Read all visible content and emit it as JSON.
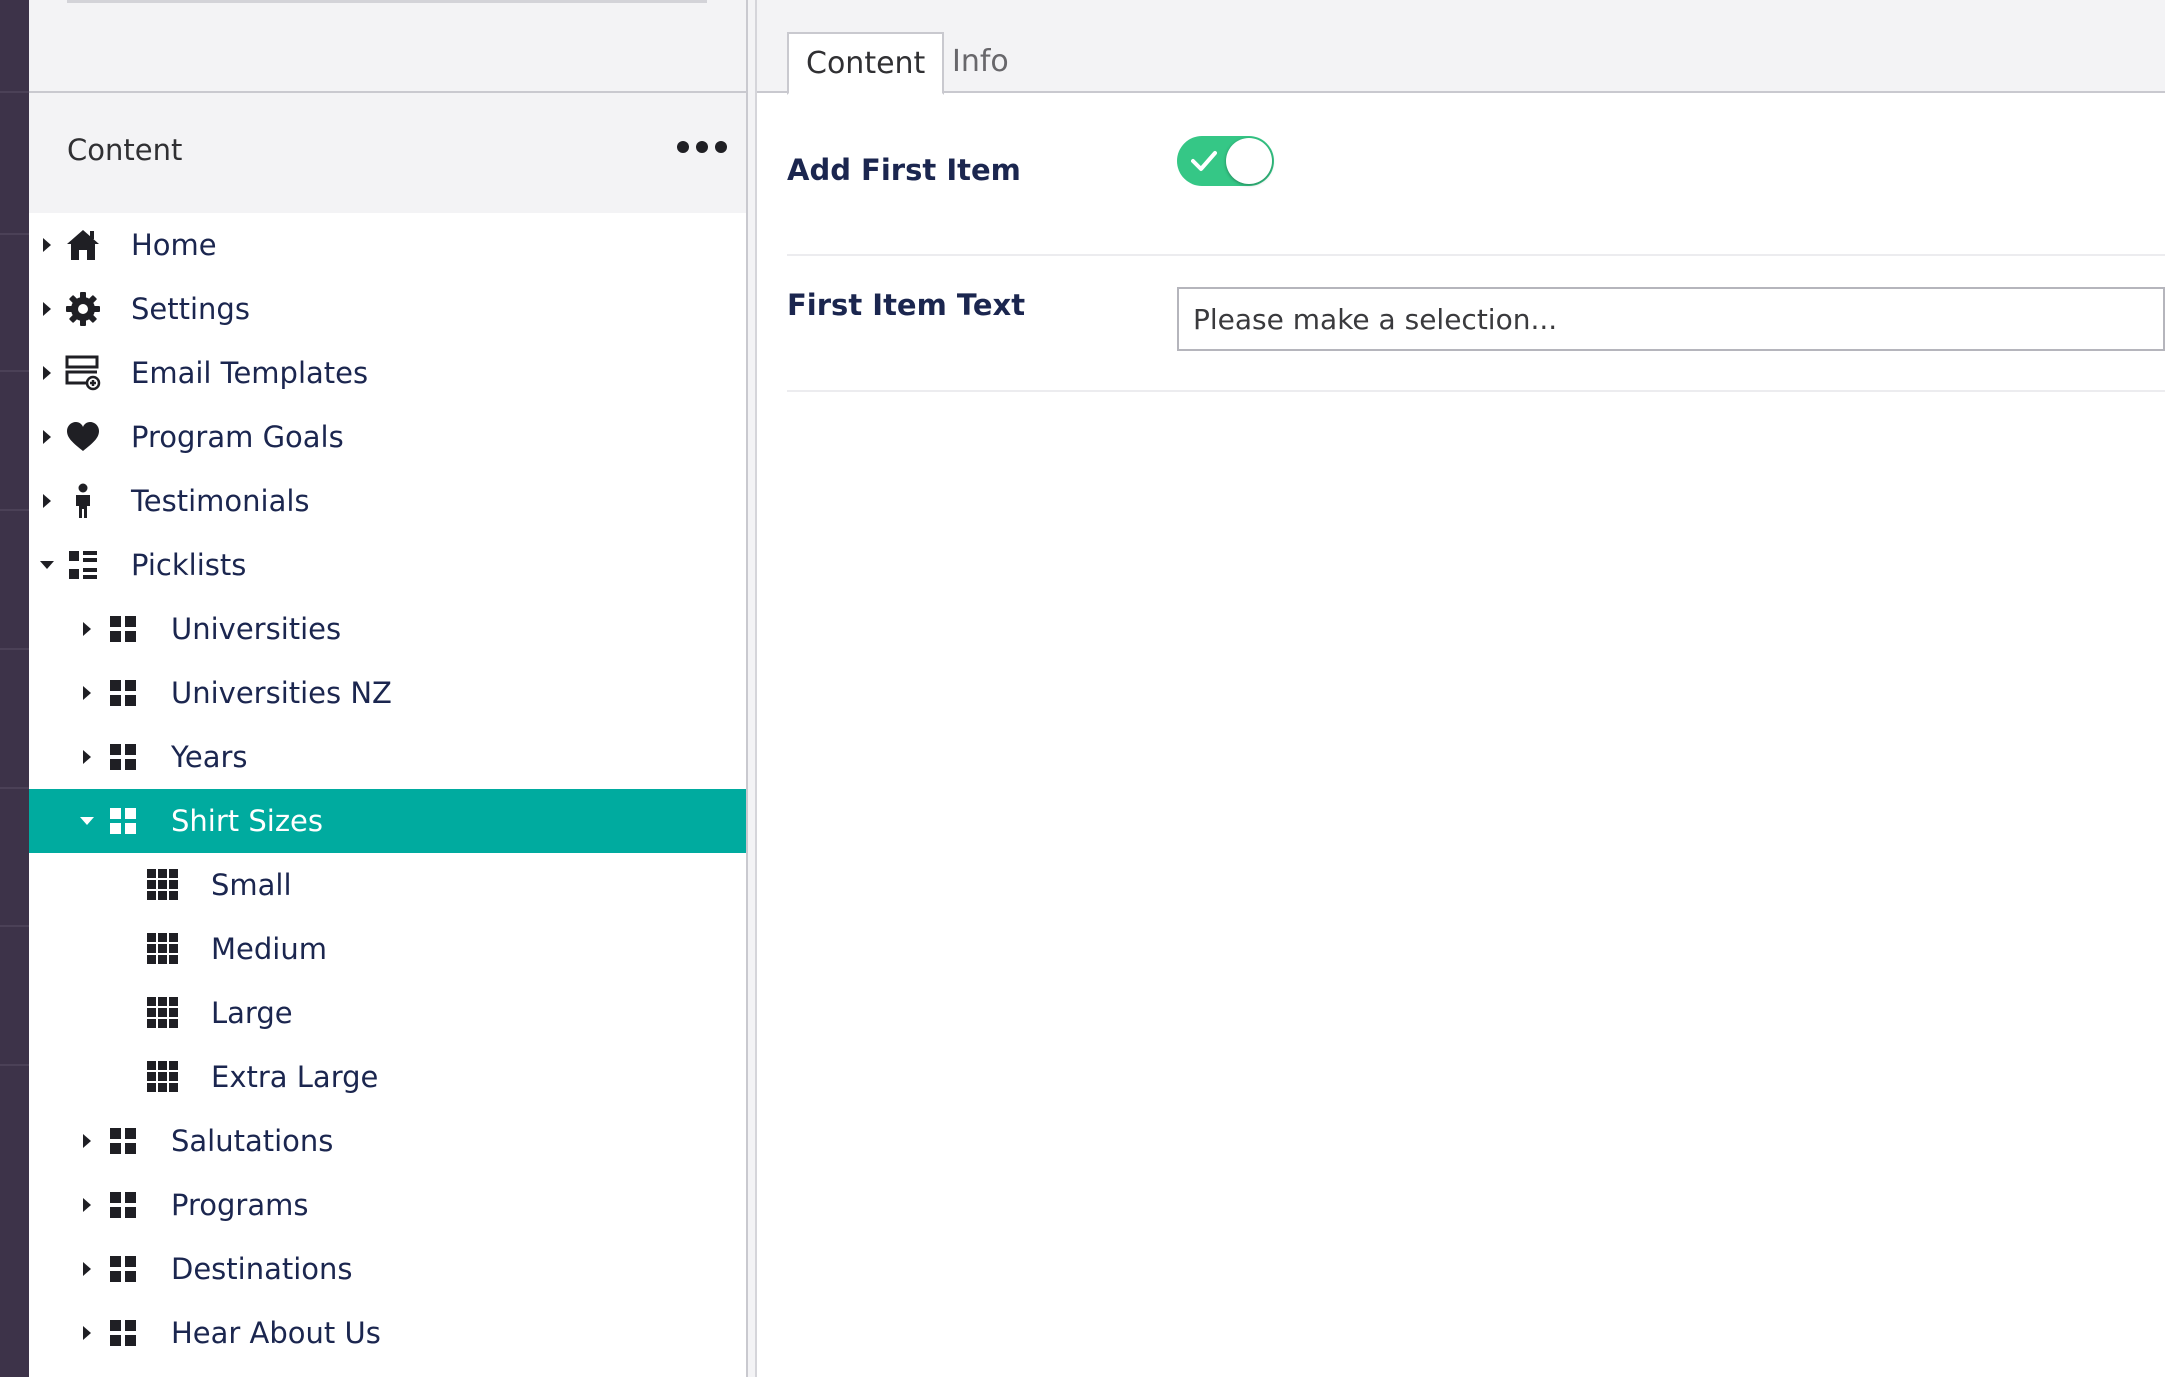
{
  "tree": {
    "header_title": "Content",
    "items": [
      {
        "label": "Home",
        "icon": "home-icon",
        "level": 0,
        "caret": "right"
      },
      {
        "label": "Settings",
        "icon": "gear-icon",
        "level": 0,
        "caret": "right"
      },
      {
        "label": "Email Templates",
        "icon": "email-template-icon",
        "level": 0,
        "caret": "right"
      },
      {
        "label": "Program Goals",
        "icon": "heart-icon",
        "level": 0,
        "caret": "right"
      },
      {
        "label": "Testimonials",
        "icon": "person-icon",
        "level": 0,
        "caret": "right"
      },
      {
        "label": "Picklists",
        "icon": "list-icon",
        "level": 0,
        "caret": "down"
      },
      {
        "label": "Universities",
        "icon": "grid-icon",
        "level": 1,
        "caret": "right"
      },
      {
        "label": "Universities NZ",
        "icon": "grid-icon",
        "level": 1,
        "caret": "right"
      },
      {
        "label": "Years",
        "icon": "grid-icon",
        "level": 1,
        "caret": "right"
      },
      {
        "label": "Shirt Sizes",
        "icon": "grid-icon",
        "level": 1,
        "caret": "down",
        "selected": true
      },
      {
        "label": "Small",
        "icon": "dense-grid-icon",
        "level": 2,
        "caret": "none"
      },
      {
        "label": "Medium",
        "icon": "dense-grid-icon",
        "level": 2,
        "caret": "none"
      },
      {
        "label": "Large",
        "icon": "dense-grid-icon",
        "level": 2,
        "caret": "none"
      },
      {
        "label": "Extra Large",
        "icon": "dense-grid-icon",
        "level": 2,
        "caret": "none"
      },
      {
        "label": "Salutations",
        "icon": "grid-icon",
        "level": 1,
        "caret": "right"
      },
      {
        "label": "Programs",
        "icon": "grid-icon",
        "level": 1,
        "caret": "right"
      },
      {
        "label": "Destinations",
        "icon": "grid-icon",
        "level": 1,
        "caret": "right"
      },
      {
        "label": "Hear About Us",
        "icon": "grid-icon",
        "level": 1,
        "caret": "right"
      }
    ]
  },
  "editor": {
    "tabs": [
      {
        "label": "Content",
        "active": true
      },
      {
        "label": "Info",
        "active": false
      }
    ],
    "properties": {
      "add_first_item": {
        "label": "Add First Item",
        "value": true
      },
      "first_item_text": {
        "label": "First Item Text",
        "value": "",
        "placeholder": "Please make a selection..."
      }
    }
  },
  "colors": {
    "app_rail": "#3d3349",
    "selected_item": "#00ab9f",
    "toggle_on": "#35c786"
  }
}
